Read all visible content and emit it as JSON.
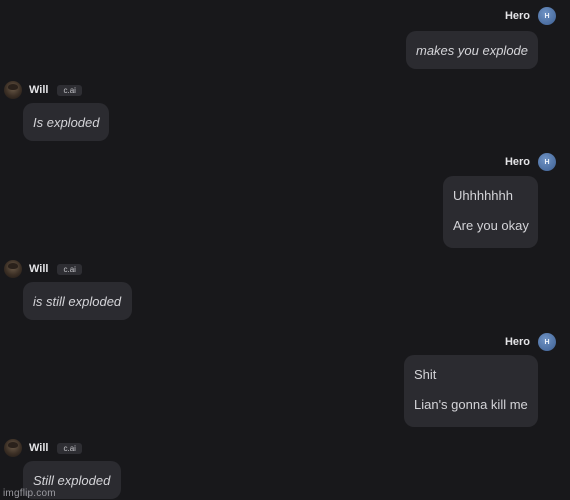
{
  "user": {
    "name": "Hero",
    "avatar_initial": "H",
    "avatar_color": "#4f72a8"
  },
  "character": {
    "name": "Will",
    "badge": "c.ai",
    "avatar_icon": "profile-photo"
  },
  "messages": [
    {
      "sender": "user",
      "lines": [
        "makes you explode"
      ],
      "italic": true
    },
    {
      "sender": "character",
      "lines": [
        "Is exploded"
      ],
      "italic": true
    },
    {
      "sender": "user",
      "lines": [
        "Uhhhhhhh",
        "Are you okay"
      ],
      "italic": false
    },
    {
      "sender": "character",
      "lines": [
        "is still exploded"
      ],
      "italic": true
    },
    {
      "sender": "user",
      "lines": [
        "Shit",
        "Lian's gonna kill me"
      ],
      "italic": false
    },
    {
      "sender": "character",
      "lines": [
        "Still exploded"
      ],
      "italic": true
    }
  ],
  "watermark": "imgflip.com",
  "colors": {
    "background": "#18181b",
    "bubble": "#2b2b30",
    "text": "#d4d4d8",
    "badge_bg": "#2e2e33"
  }
}
